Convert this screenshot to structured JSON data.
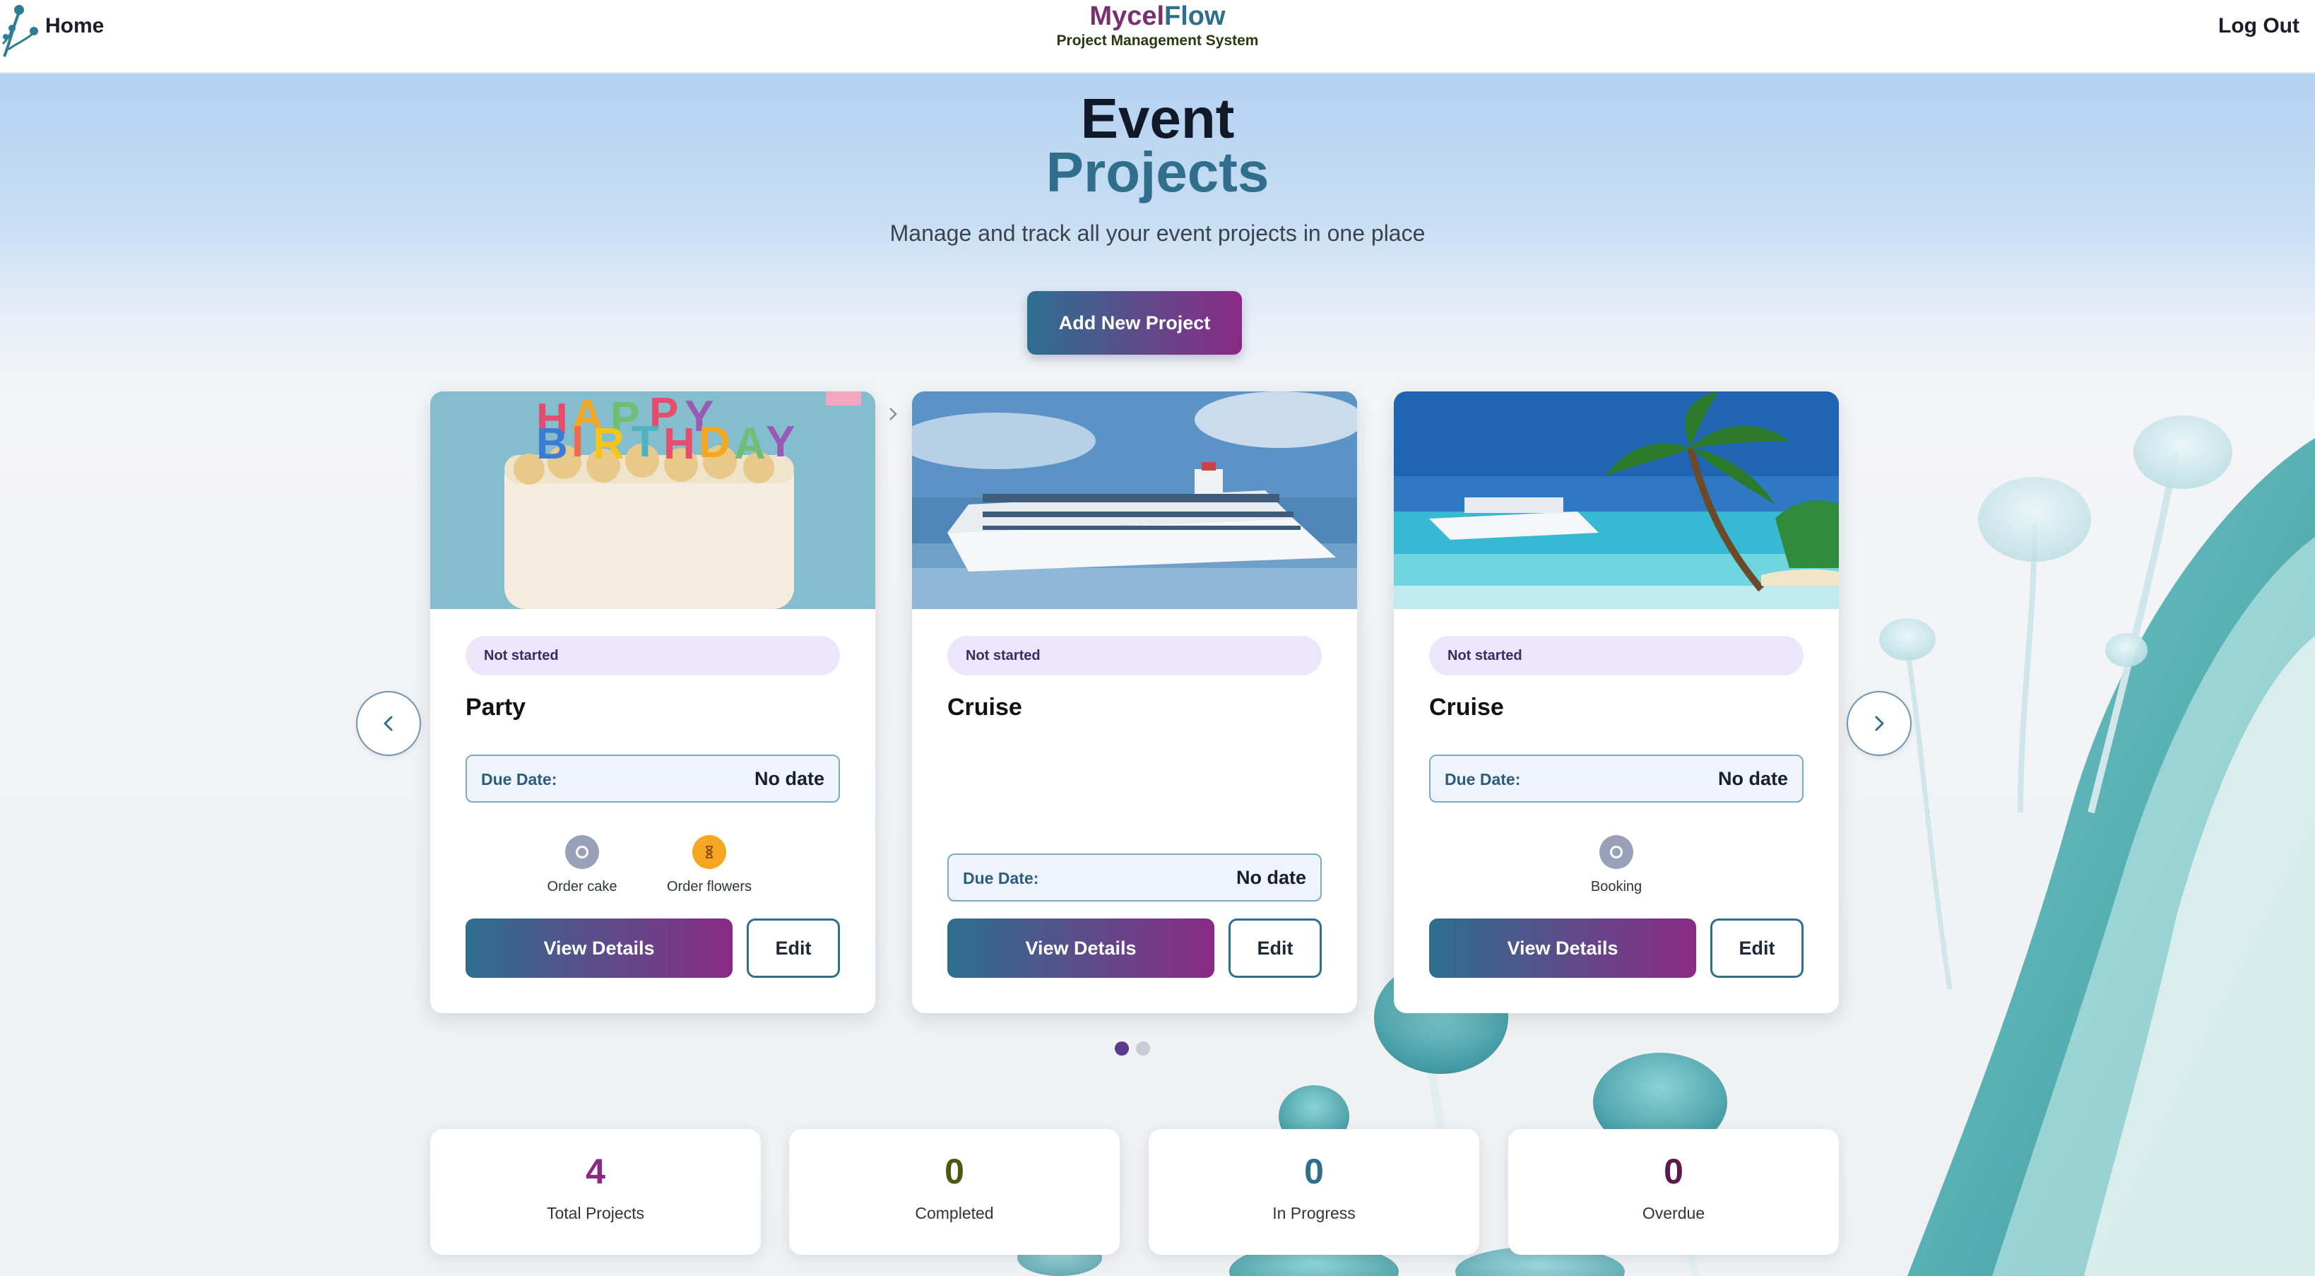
{
  "nav": {
    "home_label": "Home",
    "brand_part1": "Mycel",
    "brand_part2": "Flow",
    "brand_subtitle": "Project Management System",
    "logout_label": "Log Out"
  },
  "hero": {
    "title_line1": "Event",
    "title_line2": "Projects",
    "subtitle": "Manage and track all your event projects in one place",
    "add_button": "Add New Project"
  },
  "cards": [
    {
      "image": "birthday-cake-photo",
      "status": "Not started",
      "title": "Party",
      "due_label": "Due Date:",
      "due_value": "No date",
      "tasks": [
        {
          "label": "Order cake",
          "icon": "circle-icon",
          "color": "#98a1b7"
        },
        {
          "label": "Order flowers",
          "icon": "hourglass-icon",
          "color": "#f5a623"
        }
      ],
      "view_label": "View Details",
      "edit_label": "Edit"
    },
    {
      "image": "cruise-ship-photo",
      "status": "Not started",
      "title": "Cruise",
      "due_label": "Due Date:",
      "due_value": "No date",
      "tasks": [],
      "view_label": "View Details",
      "edit_label": "Edit"
    },
    {
      "image": "tropical-cruise-photo",
      "status": "Not started",
      "title": "Cruise",
      "due_label": "Due Date:",
      "due_value": "No date",
      "tasks": [
        {
          "label": "Booking",
          "icon": "circle-icon",
          "color": "#98a1b7"
        }
      ],
      "view_label": "View Details",
      "edit_label": "Edit"
    }
  ],
  "carousel": {
    "pages": 2,
    "active_page": 1
  },
  "stats": [
    {
      "value": "4",
      "label": "Total Projects",
      "color": "#8a2a86"
    },
    {
      "value": "0",
      "label": "Completed",
      "color": "#4a5a12"
    },
    {
      "value": "0",
      "label": "In Progress",
      "color": "#2e6f8d"
    },
    {
      "value": "0",
      "label": "Overdue",
      "color": "#5a1a4e"
    }
  ],
  "colors": {
    "gradient_start": "#2d6f8e",
    "gradient_end": "#8a2a86",
    "badge_bg": "#ece6fb"
  }
}
